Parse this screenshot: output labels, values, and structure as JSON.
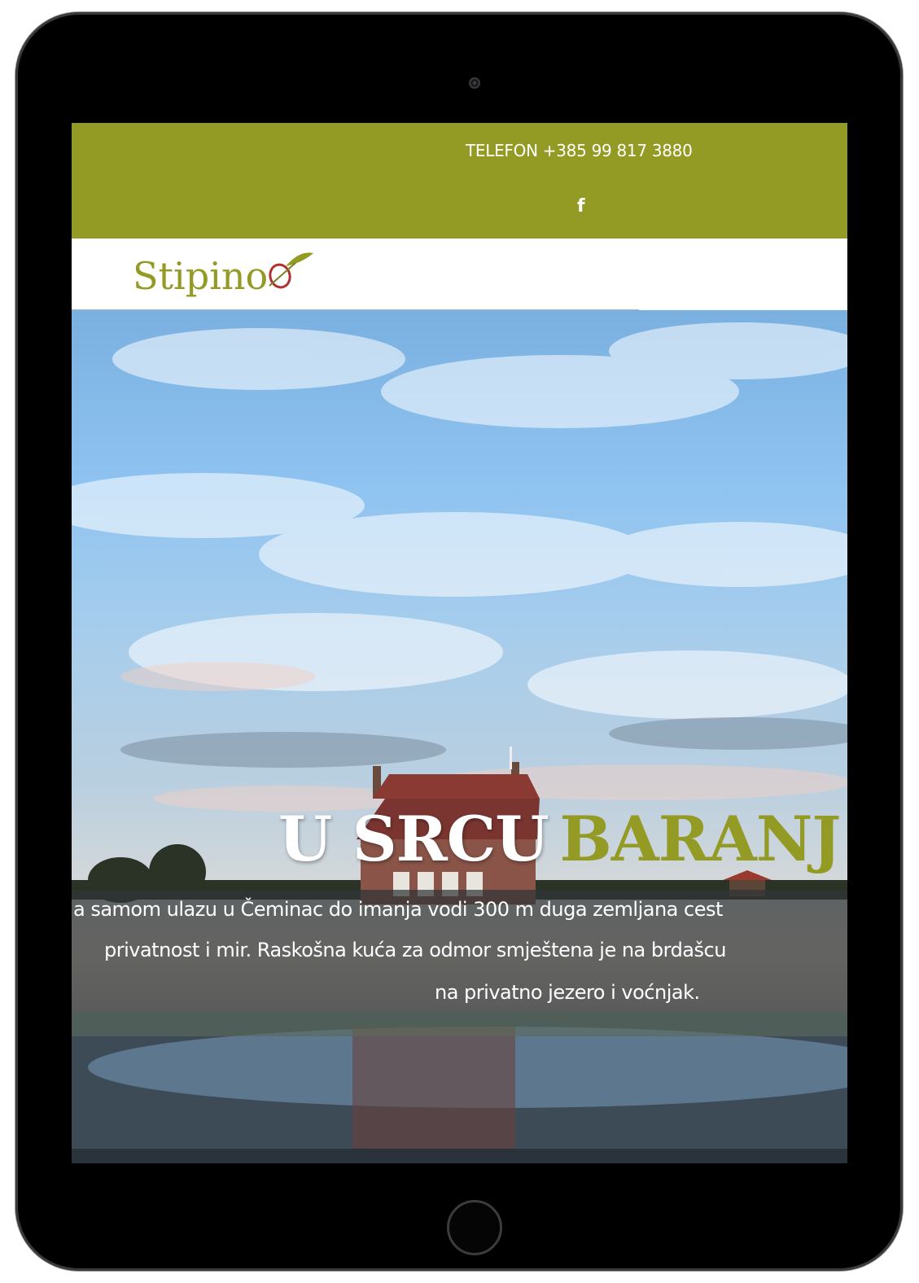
{
  "topbar": {
    "phone": "TELEFON +385 99 817 3880",
    "social_icon": "facebook-icon",
    "social_glyph": "f",
    "color": "#949b25"
  },
  "header": {
    "logo_text": "Stipino",
    "logo_color": "#949b25"
  },
  "hero": {
    "headline_white": "U SRCU",
    "headline_green": "BARANJ",
    "headline_green_color": "#949b25",
    "lines": [
      "a samom ulazu u Čeminac do imanja vodi 300 m duga zemljana cest",
      "privatnost i mir. Raskošna kuća za odmor smještena je na brdašcu",
      "na privatno jezero i voćnjak."
    ]
  }
}
